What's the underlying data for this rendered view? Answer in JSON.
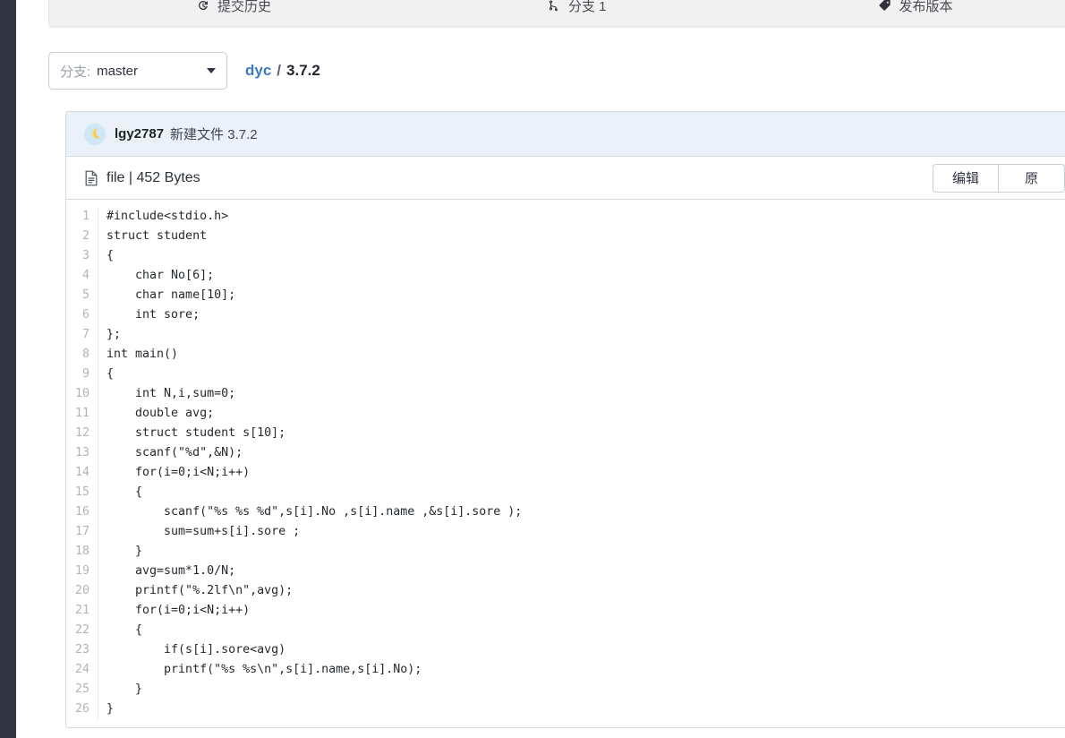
{
  "toolbar": {
    "items": [
      {
        "label": "提交历史",
        "icon": "history-icon"
      },
      {
        "label": "分支 1",
        "icon": "branch-icon"
      },
      {
        "label": "发布版本",
        "icon": "tag-icon"
      }
    ]
  },
  "branch": {
    "label": "分支:",
    "value": "master",
    "caret_icon": "chevron-down-icon"
  },
  "breadcrumb": {
    "repo": "dyc",
    "separator": "/",
    "current": "3.7.2"
  },
  "commit": {
    "avatar_icon": "user-avatar",
    "user": "lgy2787",
    "message": "新建文件 3.7.2"
  },
  "file": {
    "icon": "file-icon",
    "meta": "file | 452 Bytes",
    "name": "file",
    "size": "452 Bytes",
    "actions": [
      {
        "label": "编辑"
      },
      {
        "label": "原"
      }
    ]
  },
  "code": {
    "language": "c",
    "line_count": 26,
    "lines": [
      "#include<stdio.h>",
      "struct student",
      "{",
      "    char No[6];",
      "    char name[10];",
      "    int sore;",
      "};",
      "int main()",
      "{",
      "    int N,i,sum=0;",
      "    double avg;",
      "    struct student s[10];",
      "    scanf(\"%d\",&N);",
      "    for(i=0;i<N;i++)",
      "    {",
      "        scanf(\"%s %s %d\",s[i].No ,s[i].name ,&s[i].sore );",
      "        sum=sum+s[i].sore ;",
      "    }",
      "    avg=sum*1.0/N;",
      "    printf(\"%.2lf\\n\",avg);",
      "    for(i=0;i<N;i++)",
      "    {",
      "        if(s[i].sore<avg)",
      "        printf(\"%s %s\\n\",s[i].name,s[i].No);",
      "    }",
      "}"
    ]
  },
  "colors": {
    "rail": "#2f3542",
    "link": "#3d7bbf",
    "commit_bar_bg": "#eaf1f8",
    "toolbar_bg": "#f1f1f1",
    "panel_border": "#d6dbe0"
  }
}
